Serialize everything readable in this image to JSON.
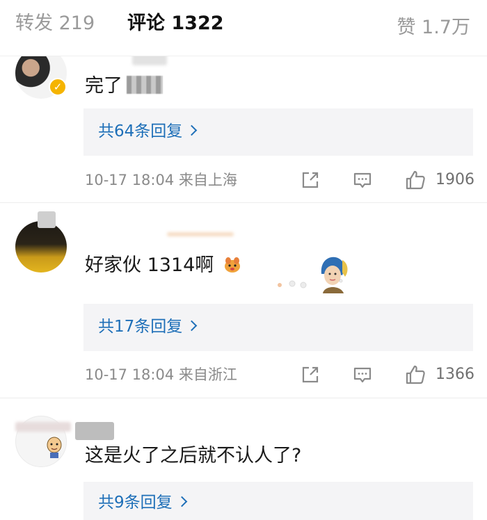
{
  "tabs": {
    "repost_label": "转发 219",
    "comments_label": "评论 1322",
    "likes_label": "赞 1.7万"
  },
  "comments": [
    {
      "text": "完了",
      "reply_summary": "共64条回复",
      "time_location": "10-17 18:04 来自上海",
      "like_count": "1906"
    },
    {
      "text": "好家伙 1314啊",
      "reply_summary": "共17条回复",
      "time_location": "10-17 18:04 来自浙江",
      "like_count": "1366"
    },
    {
      "text": "这是火了之后就不认人了?",
      "reply_summary": "共9条回复"
    }
  ],
  "colors": {
    "link": "#1e6fb8",
    "verified": "#f5b400"
  }
}
